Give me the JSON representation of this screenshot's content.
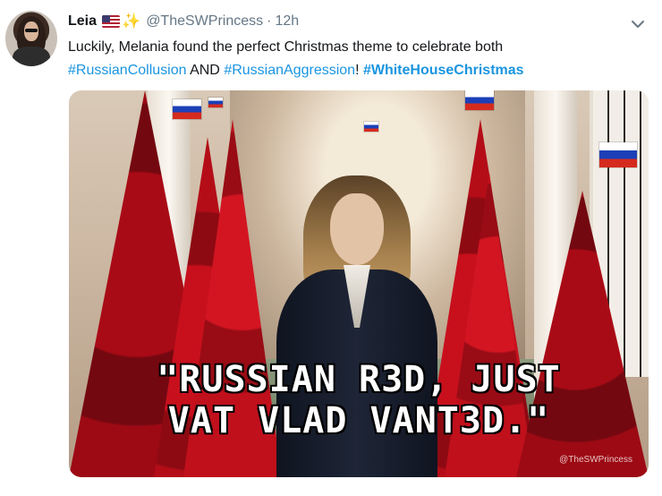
{
  "tweet": {
    "author_name": "Leia",
    "handle": "@TheSWPrincess",
    "separator": "·",
    "timestamp": "12h",
    "emoji_flag": "us-flag",
    "emoji_sparkles": "✨",
    "text_part1": "Luckily, Melania found the perfect Christmas theme to celebrate both",
    "hashtag1": "#RussianCollusion",
    "text_and": " AND ",
    "hashtag2": "#RussianAggression",
    "text_excl": "! ",
    "hashtag3": "#WhiteHouseChristmas",
    "hashtag_color": "#1b95e0",
    "muted_color": "#657786"
  },
  "media": {
    "caption_line1": "\"RUSSIAN R3D, JUST",
    "caption_line2": "VAT VLAD VANT3D.\"",
    "watermark": "@TheSWPrincess"
  },
  "icons": {
    "menu": "chevron-down-icon"
  }
}
